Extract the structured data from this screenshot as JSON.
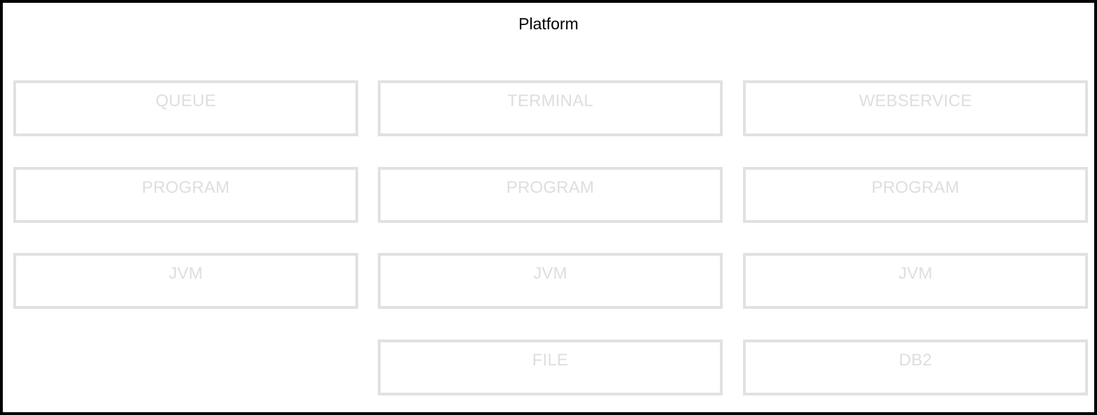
{
  "platform": {
    "title": "Platform"
  },
  "nodes": {
    "queue": "QUEUE",
    "terminal": "TERMINAL",
    "webservice": "WEBSERVICE",
    "program_1": "PROGRAM",
    "program_2": "PROGRAM",
    "program_3": "PROGRAM",
    "jvm_1": "JVM",
    "jvm_2": "JVM",
    "jvm_3": "JVM",
    "file": "FILE",
    "db2": "DB2"
  },
  "colors": {
    "platform_border": "#000000",
    "node_border": "#e1e1e1",
    "node_text": "#dedede"
  }
}
